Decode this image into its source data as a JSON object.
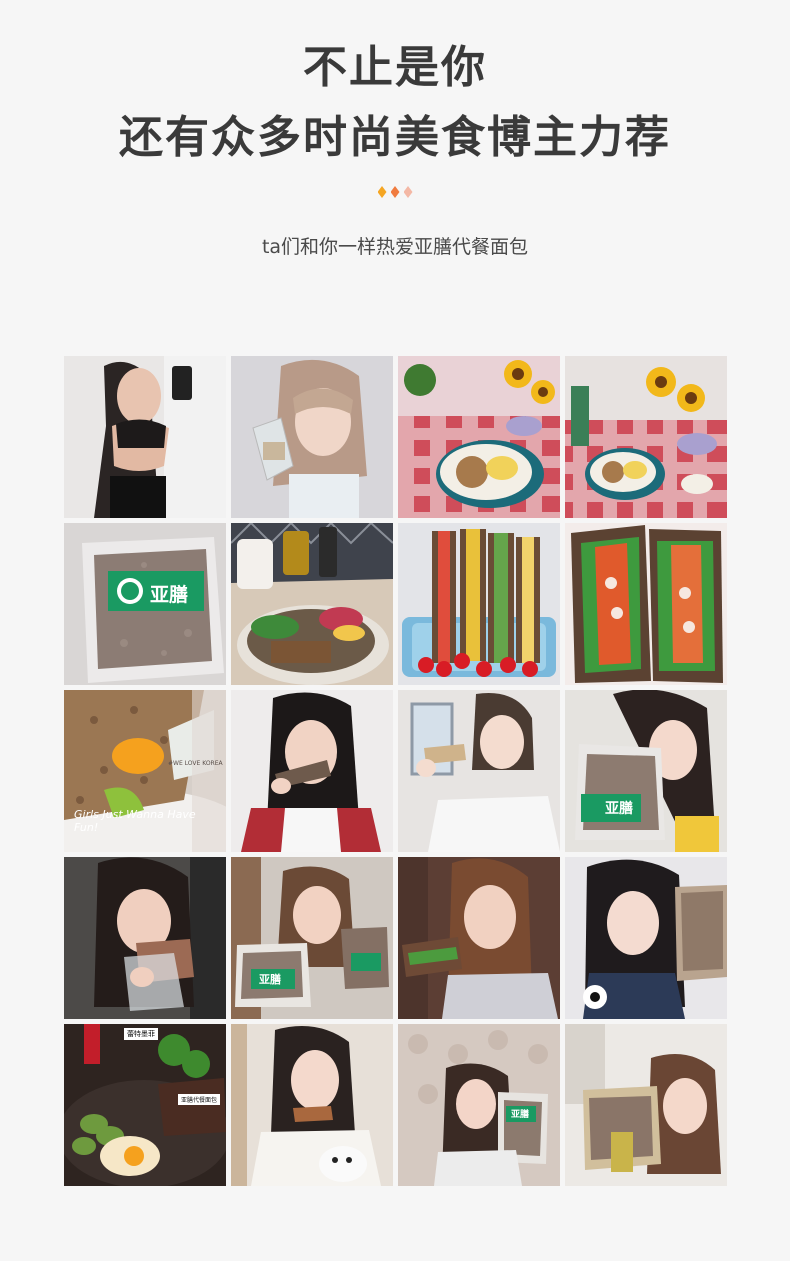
{
  "header": {
    "title_line_1": "不止是你",
    "title_line_2": "还有众多时尚美食博主力荐",
    "subtitle": "ta们和你一样热爱亚膳代餐面包",
    "diamond_colors": [
      "#f5a623",
      "#f07b3f",
      "#f4b8a5"
    ]
  },
  "gallery": {
    "tiles": [
      {
        "subject": "woman-fitness-selfie"
      },
      {
        "subject": "woman-holding-bread"
      },
      {
        "subject": "breakfast-plate-sunflowers"
      },
      {
        "subject": "breakfast-table-sunflowers"
      },
      {
        "subject": "bread-package",
        "brand_label": "亚膳"
      },
      {
        "subject": "salad-bowl-with-bread"
      },
      {
        "subject": "sandwich-tray-tomatoes"
      },
      {
        "subject": "sandwich-closeup"
      },
      {
        "subject": "bread-with-egg-plate",
        "plate_text": "Girls Just Wanna Have Fun!",
        "tag_text": "#WE LOVE KOREA"
      },
      {
        "subject": "woman-eating-bread"
      },
      {
        "subject": "woman-holding-sandwich"
      },
      {
        "subject": "woman-with-bread-package",
        "brand_label": "亚膳"
      },
      {
        "subject": "woman-eating-in-car"
      },
      {
        "subject": "woman-holding-packages",
        "brand_label": "亚膳"
      },
      {
        "subject": "woman-with-sandwich"
      },
      {
        "subject": "woman-with-bread-loaf"
      },
      {
        "subject": "meal-plate-dark",
        "label_1": "蕾特墨菲",
        "label_2": "亚膳代餐面包"
      },
      {
        "subject": "woman-with-dog"
      },
      {
        "subject": "woman-with-package",
        "brand_label": "亚膳"
      },
      {
        "subject": "woman-with-bread-stack"
      }
    ]
  }
}
